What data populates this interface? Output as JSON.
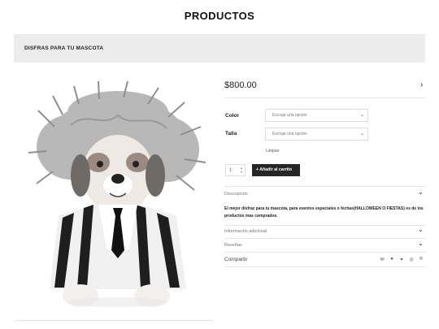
{
  "page": {
    "title": "PRODUCTOS"
  },
  "banner": {
    "text": "DISFRAS PARA TU MASCOTA"
  },
  "product": {
    "price": "$800.00",
    "options": [
      {
        "label": "Color",
        "placeholder": "Escoge una opción"
      },
      {
        "label": "Talla",
        "placeholder": "Escoge una opción"
      }
    ],
    "clear_label": "Limpiar",
    "quantity": "1",
    "add_to_cart": "Añadir al carrito"
  },
  "accordion": {
    "description_label": "Descripción",
    "description_text": "El mejor disfraz para tu mascota, para eventos especiales o fechas(HALLOWEEN O FIESTAS) es de los productos mas comprados.",
    "additional_label": "Información adicional",
    "reviews_label": "Reseñas"
  },
  "share": {
    "label": "Compartir",
    "icons": [
      "mail-icon",
      "facebook-icon",
      "twitter-icon",
      "instagram-icon",
      "pinterest-icon"
    ]
  }
}
